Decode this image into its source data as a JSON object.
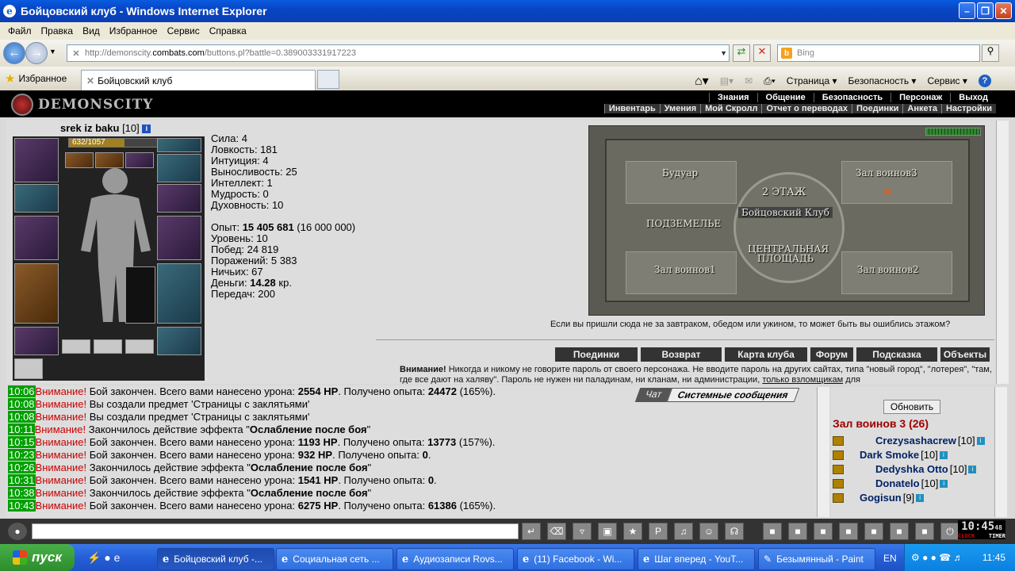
{
  "window": {
    "title": "Бойцовский клуб - Windows Internet Explorer"
  },
  "menu": [
    "Файл",
    "Правка",
    "Вид",
    "Избранное",
    "Сервис",
    "Справка"
  ],
  "address": {
    "prefix": "http://demonscity.",
    "domain": "combats.com",
    "suffix": "/buttons.pl?battle=0.389003331917223"
  },
  "search": {
    "placeholder": "Bing"
  },
  "tabs": {
    "favorites": "Избранное",
    "active": "Бойцовский клуб"
  },
  "tools": [
    "Страница",
    "Безопасность",
    "Сервис"
  ],
  "game": {
    "logo": "DEMONSCITY",
    "nav_top": [
      "Знания",
      "Общение",
      "Безопасность",
      "Персонаж",
      "Выход"
    ],
    "nav_sub": [
      "Инвентарь",
      "Умения",
      "Мой Скролл",
      "Отчет о переводах",
      "Поединки",
      "Анкета",
      "Настройки"
    ],
    "player": {
      "name": "srek iz baku",
      "level": "[10]",
      "hp": "632/1057",
      "hp_fraction": 0.6
    },
    "stats": [
      "Сила: 4",
      "Ловкость: 181",
      "Интуиция: 4",
      "Выносливость: 25",
      "Интеллект: 1",
      "Мудрость: 0",
      "Духовность: 10"
    ],
    "info": {
      "exp_label": "Опыт:",
      "exp_value": "15 405 681",
      "exp_next": "(16 000 000)",
      "level": "Уровень: 10",
      "wins": "Побед: 24 819",
      "losses": "Поражений: 5 383",
      "draws": "Ничьих: 67",
      "money_label": "Деньги:",
      "money_value": "14.28",
      "money_unit": "кр.",
      "transfers": "Передач: 200"
    },
    "map": {
      "rooms": [
        "Будуар",
        "Зал воинов3",
        "2 ЭТАЖ",
        "Бойцовский Клуб",
        "ПОДЗЕМЕЛЬЕ",
        "ЦЕНТРАЛЬНАЯ",
        "ПЛОЩАДЬ",
        "Зал воинов1",
        "Зал воинов2"
      ],
      "hint": "Если вы пришли сюда не за завтраком, обедом или ужином, то может быть вы ошиблись этажом?"
    },
    "map_buttons": [
      "Поединки",
      "Возврат",
      "Карта клуба",
      "Форум",
      "Подсказка",
      "Объекты"
    ],
    "warning": {
      "bold": "Внимание!",
      "text": " Никогда и никому не говорите пароль от своего персонажа. Не вводите пароль на других сайтах, типа \"новый город\", \"лотерея\", \"там, где все дают на халяву\". Пароль не нужен ни паладинам, ни кланам, ни администрации,",
      "link": "только взломщикам",
      "tail": " для"
    }
  },
  "chat": {
    "tabs": [
      "Чат",
      "Системные сообщения"
    ],
    "lines": [
      {
        "time": "10:06",
        "w": "Внимание!",
        "a": " Бой закончен. Всего вами нанесено урона: ",
        "b": "2554 HP",
        "c": ". Получено опыта: ",
        "d": "24472",
        "e": " (165%)."
      },
      {
        "time": "10:08",
        "w": "Внимание!",
        "a": " Вы создали предмет 'Страницы с заклятьями'",
        "b": "",
        "c": "",
        "d": "",
        "e": ""
      },
      {
        "time": "10:08",
        "w": "Внимание!",
        "a": " Вы создали предмет 'Страницы с заклятьями'",
        "b": "",
        "c": "",
        "d": "",
        "e": ""
      },
      {
        "time": "10:11",
        "w": "Внимание!",
        "a": " Закончилось действие эффекта \"",
        "b": "Ослабление после боя",
        "c": "\"",
        "d": "",
        "e": ""
      },
      {
        "time": "10:15",
        "w": "Внимание!",
        "a": " Бой закончен. Всего вами нанесено урона: ",
        "b": "1193 HP",
        "c": ". Получено опыта: ",
        "d": "13773",
        "e": " (157%)."
      },
      {
        "time": "10:23",
        "w": "Внимание!",
        "a": " Бой закончен. Всего вами нанесено урона: ",
        "b": "932 HP",
        "c": ". Получено опыта: ",
        "d": "0",
        "e": "."
      },
      {
        "time": "10:26",
        "w": "Внимание!",
        "a": " Закончилось действие эффекта \"",
        "b": "Ослабление после боя",
        "c": "\"",
        "d": "",
        "e": ""
      },
      {
        "time": "10:31",
        "w": "Внимание!",
        "a": " Бой закончен. Всего вами нанесено урона: ",
        "b": "1541 HP",
        "c": ". Получено опыта: ",
        "d": "0",
        "e": "."
      },
      {
        "time": "10:38",
        "w": "Внимание!",
        "a": " Закончилось действие эффекта \"",
        "b": "Ослабление после боя",
        "c": "\"",
        "d": "",
        "e": ""
      },
      {
        "time": "10:43",
        "w": "Внимание!",
        "a": " Бой закончен. Всего вами нанесено урона: ",
        "b": "6275 HP",
        "c": ". Получено опыта: ",
        "d": "61386",
        "e": " (165%)."
      }
    ]
  },
  "users": {
    "refresh": "Обновить",
    "room": "Зал воинов 3 (26)",
    "list": [
      {
        "name": "Crezysashacrew",
        "level": "[10]"
      },
      {
        "name": "Dark Smoke",
        "level": "[10]"
      },
      {
        "name": "Dedyshka Otto",
        "level": "[10]"
      },
      {
        "name": "Donatelo",
        "level": "[10]"
      },
      {
        "name": "Gogisun",
        "level": "[9]"
      }
    ]
  },
  "clock": {
    "time": "10:45",
    "sec": "48",
    "left": "CLOCK",
    "right": "TIMER"
  },
  "taskbar": {
    "start": "пуск",
    "items": [
      "Бойцовский клуб -...",
      "Социальная сеть ...",
      "Аудиозаписи Rovs...",
      "(11) Facebook - Wi...",
      "Шаг вперед - YouT...",
      "Безымянный - Paint"
    ],
    "lang": "EN",
    "time": "11:45"
  }
}
